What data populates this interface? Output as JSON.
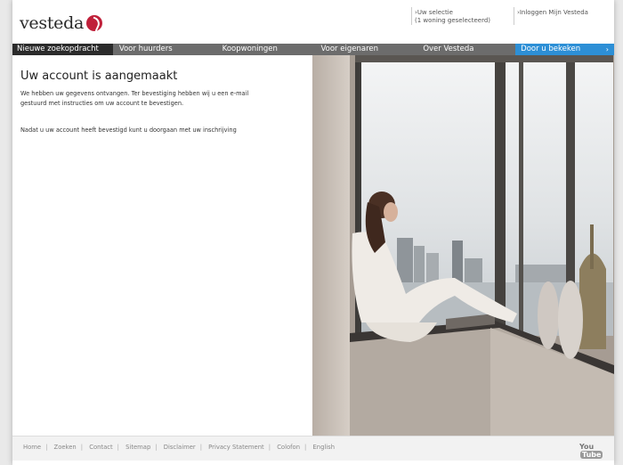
{
  "header": {
    "logo_text": "vesteda",
    "selection_line1": "Uw selectie",
    "selection_line2": "(1 woning geselecteerd)",
    "login_label": "Inloggen Mijn Vesteda"
  },
  "nav": {
    "items": [
      {
        "label": "Nieuwe zoekopdracht"
      },
      {
        "label": "Voor huurders"
      },
      {
        "label": "Koopwoningen"
      },
      {
        "label": "Voor eigenaren"
      },
      {
        "label": "Over Vesteda"
      },
      {
        "label": "Door u bekeken"
      }
    ],
    "chevron": "›"
  },
  "main": {
    "title": "Uw account is aangemaakt",
    "para1_line1": "We hebben uw gegevens ontvangen. Ter bevestiging hebben wij u een e-mail",
    "para1_line2": "gestuurd met instructies om uw account te bevestigen.",
    "para2": "Nadat u uw account heeft bevestigd kunt u doorgaan met uw inschrijving"
  },
  "footer": {
    "links": [
      "Home",
      "Zoeken",
      "Contact",
      "Sitemap",
      "Disclaimer",
      "Privacy Statement",
      "Colofon",
      "English"
    ],
    "youtube_you": "You",
    "youtube_tube": "Tube"
  },
  "colors": {
    "brand_red": "#c0203a",
    "nav_grey": "#6c6c6c",
    "nav_active": "#2b2b2b",
    "nav_blue": "#2d8fd6"
  }
}
